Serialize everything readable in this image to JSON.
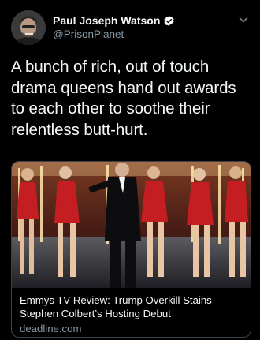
{
  "user": {
    "display_name": "Paul Joseph Watson",
    "handle": "@PrisonPlanet"
  },
  "tweet": {
    "text": "A bunch of rich, out of touch drama queens hand out awards to each other to soothe their relentless butt-hurt."
  },
  "card": {
    "title": "Emmys TV Review: Trump Overkill Stains Stephen Colbert’s Hosting Debut",
    "domain": "deadline.com"
  },
  "icons": {
    "verified": "verified-badge-icon",
    "menu": "chevron-down-icon"
  },
  "colors": {
    "background": "#000000",
    "primary_text": "#f5f8fa",
    "secondary_text": "#8899a6",
    "verified_badge": "#ffffff",
    "card_border": "#38444d"
  }
}
